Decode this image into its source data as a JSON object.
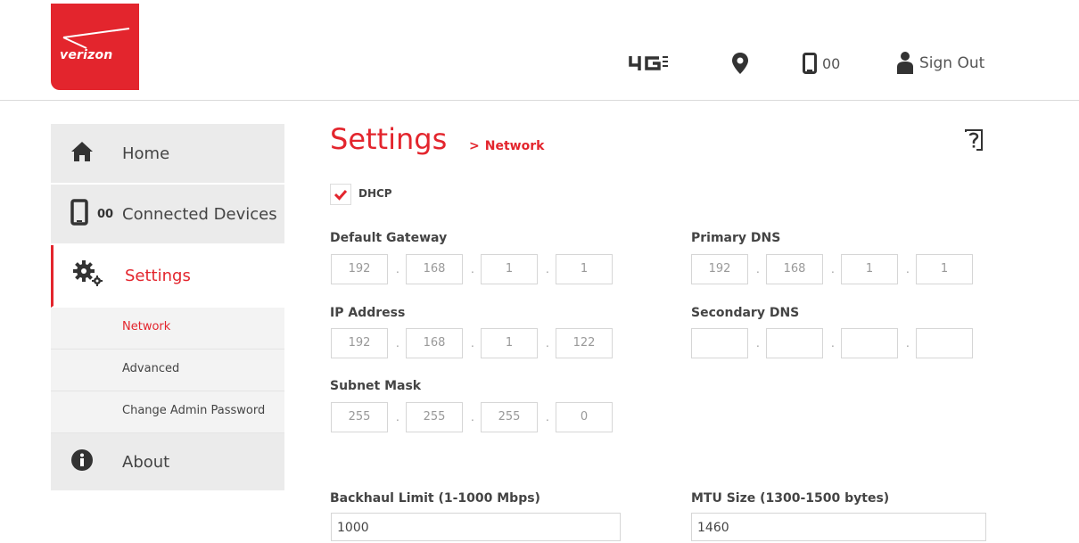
{
  "brand": {
    "name": "verizon",
    "color": "#e3252d"
  },
  "header": {
    "network_icon": "4g-lte-icon",
    "location_icon": "location-pin-icon",
    "device_count": "00",
    "sign_out": "Sign Out"
  },
  "sidebar": {
    "items": [
      {
        "label": "Home",
        "icon": "home-icon"
      },
      {
        "label": "Connected Devices",
        "badge": "00",
        "icon": "phone-icon"
      },
      {
        "label": "Settings",
        "icon": "gears-icon",
        "active": true
      },
      {
        "label": "About",
        "icon": "info-icon"
      }
    ],
    "sub_items": [
      {
        "label": "Network",
        "current": true
      },
      {
        "label": "Advanced"
      },
      {
        "label": "Change Admin Password"
      }
    ]
  },
  "main": {
    "title": "Settings",
    "breadcrumb": "Network",
    "dhcp": {
      "label": "DHCP",
      "checked": true
    },
    "fields": {
      "default_gateway": {
        "label": "Default Gateway",
        "octets": [
          "192",
          "168",
          "1",
          "1"
        ]
      },
      "ip_address": {
        "label": "IP Address",
        "octets": [
          "192",
          "168",
          "1",
          "122"
        ]
      },
      "subnet_mask": {
        "label": "Subnet Mask",
        "octets": [
          "255",
          "255",
          "255",
          "0"
        ]
      },
      "primary_dns": {
        "label": "Primary DNS",
        "octets": [
          "192",
          "168",
          "1",
          "1"
        ]
      },
      "secondary_dns": {
        "label": "Secondary DNS",
        "octets": [
          "",
          "",
          "",
          ""
        ]
      }
    },
    "backhaul": {
      "label": "Backhaul Limit (1-1000 Mbps)",
      "value": "1000"
    },
    "mtu": {
      "label": "MTU Size (1300-1500 bytes)",
      "value": "1460"
    },
    "octet_separator": "."
  }
}
